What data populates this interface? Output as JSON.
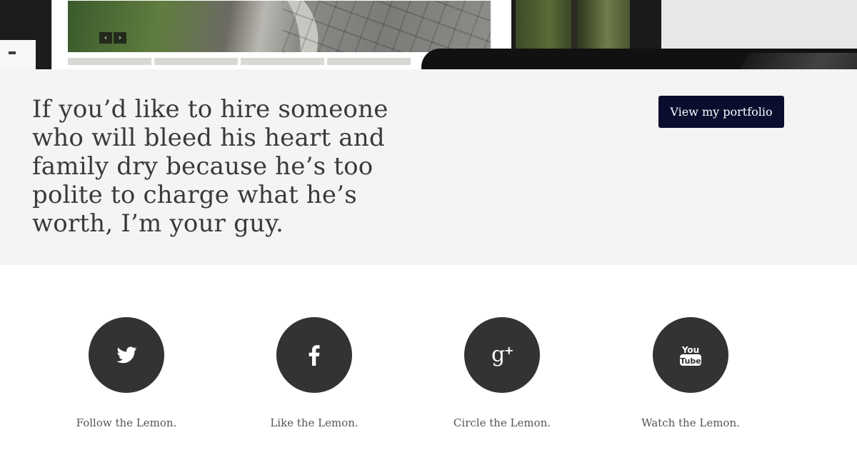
{
  "hero": {
    "slider_prev_icon": "chevron-left-icon",
    "slider_next_icon": "chevron-right-icon"
  },
  "cta": {
    "text": "If you’d like to hire someone who will bleed his heart and family dry because he’s too polite to charge what he’s worth, I’m your guy.",
    "button_label": "View my portfolio",
    "button_color": "#0a0d2e",
    "background_color": "#f4f4f4"
  },
  "social": {
    "circle_color": "#333333",
    "items": [
      {
        "icon": "twitter-icon",
        "label": "Follow the Lemon."
      },
      {
        "icon": "facebook-icon",
        "label": "Like the Lemon."
      },
      {
        "icon": "google-plus-icon",
        "label": "Circle the Lemon."
      },
      {
        "icon": "youtube-icon",
        "label": "Watch the Lemon."
      }
    ]
  }
}
